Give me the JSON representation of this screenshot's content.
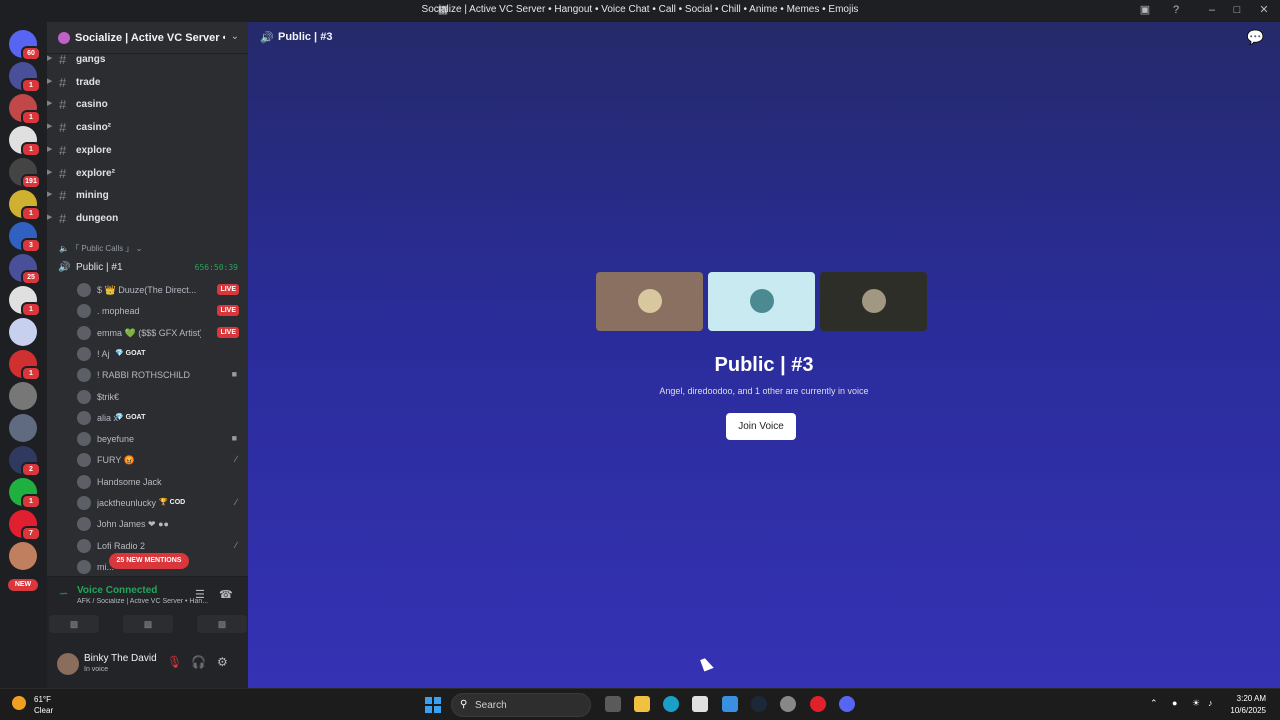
{
  "window": {
    "title": "Socialize | Active VC Server • Hangout • Voice Chat • Call • Social • Chill • Anime • Memes • Emojis"
  },
  "servers": [
    {
      "badge": "60",
      "color": "#5865f2"
    },
    {
      "badge": "1",
      "color": "#4a4f9a"
    },
    {
      "badge": "1",
      "color": "#c04848"
    },
    {
      "badge": "1",
      "color": "#e0e0e0"
    },
    {
      "badge": "191",
      "color": "#444"
    },
    {
      "badge": "1",
      "color": "#d0b030"
    },
    {
      "badge": "3",
      "color": "#3060c0"
    },
    {
      "badge": "25",
      "color": "#4a4f9a"
    },
    {
      "badge": "1",
      "color": "#e0e0e0"
    },
    {
      "badge": "",
      "color": "#c8d0f0"
    },
    {
      "badge": "1",
      "color": "#d03030"
    },
    {
      "badge": "",
      "color": "#777"
    },
    {
      "badge": "",
      "color": "#606a80"
    },
    {
      "badge": "2",
      "color": "#303a60"
    },
    {
      "badge": "1",
      "color": "#20b040"
    },
    {
      "badge": "7",
      "color": "#e02030"
    },
    {
      "badge": "",
      "color": "#c08060"
    }
  ],
  "server_new_label": "NEW",
  "server_header": {
    "name": "Socialize | Active VC Server • ..."
  },
  "text_channels": [
    "gangs",
    "trade",
    "casino",
    "casino²",
    "explore",
    "explore²",
    "mining",
    "dungeon"
  ],
  "category": {
    "label": "「 Public Calls 」"
  },
  "voice_channel": {
    "name": "Public | #1",
    "timer": "656:50:39"
  },
  "members": [
    {
      "name": "$ 👑 Duuze(The Direct...",
      "live": "LIVE",
      "icon": "",
      "tag": ""
    },
    {
      "name": ".        mophead",
      "live": "LIVE",
      "icon": "",
      "tag": ""
    },
    {
      "name": "emma 💚 ($$$ GFX Artist)",
      "live": "LIVE",
      "icon": "",
      "tag": ""
    },
    {
      "name": "! Aj",
      "live": "",
      "icon": "",
      "tag": "💎 GOAT"
    },
    {
      "name": "! RABBI ROTHSCHILD",
      "live": "",
      "icon": "■",
      "tag": ""
    },
    {
      "name": "$trik€",
      "live": "",
      "icon": "",
      "tag": ""
    },
    {
      "name": "alia x",
      "live": "",
      "icon": "",
      "tag": "💎 GOAT"
    },
    {
      "name": "beyefune",
      "live": "",
      "icon": "■",
      "tag": ""
    },
    {
      "name": "FURY 😡",
      "live": "",
      "icon": "∕",
      "tag": ""
    },
    {
      "name": "Handsome Jack",
      "live": "",
      "icon": "",
      "tag": ""
    },
    {
      "name": "jacktheunlucky",
      "live": "",
      "icon": "∕",
      "tag": "🏆 COD"
    },
    {
      "name": "John James ❤ ●●",
      "live": "",
      "icon": "",
      "tag": ""
    },
    {
      "name": "Lofi Radio 2",
      "live": "",
      "icon": "∕",
      "tag": ""
    },
    {
      "name": "mi...",
      "live": "",
      "icon": "",
      "tag": ""
    }
  ],
  "mentions_pill": "25 NEW MENTIONS",
  "voice_panel": {
    "status": "Voice Connected",
    "subtitle": "AFK / Socialize | Active VC Server • Han..."
  },
  "user_panel": {
    "name": "Binky The David",
    "status": "In voice"
  },
  "main": {
    "header_title": "Public | #3",
    "vc_title": "Public | #3",
    "vc_subtitle": "Angel, diredoodoo, and 1 other are currently in voice",
    "join_label": "Join Voice",
    "tiles": [
      {
        "bg": "#8a7060",
        "face": "#d8c8a0"
      },
      {
        "bg": "#c8eaf0",
        "face": "#4a8a90"
      },
      {
        "bg": "#2e2e28",
        "face": "#a09880"
      }
    ]
  },
  "taskbar": {
    "temp": "61°F",
    "condition": "Clear",
    "search_label": "Search",
    "time": "3:20 AM",
    "date": "10/6/2025"
  }
}
